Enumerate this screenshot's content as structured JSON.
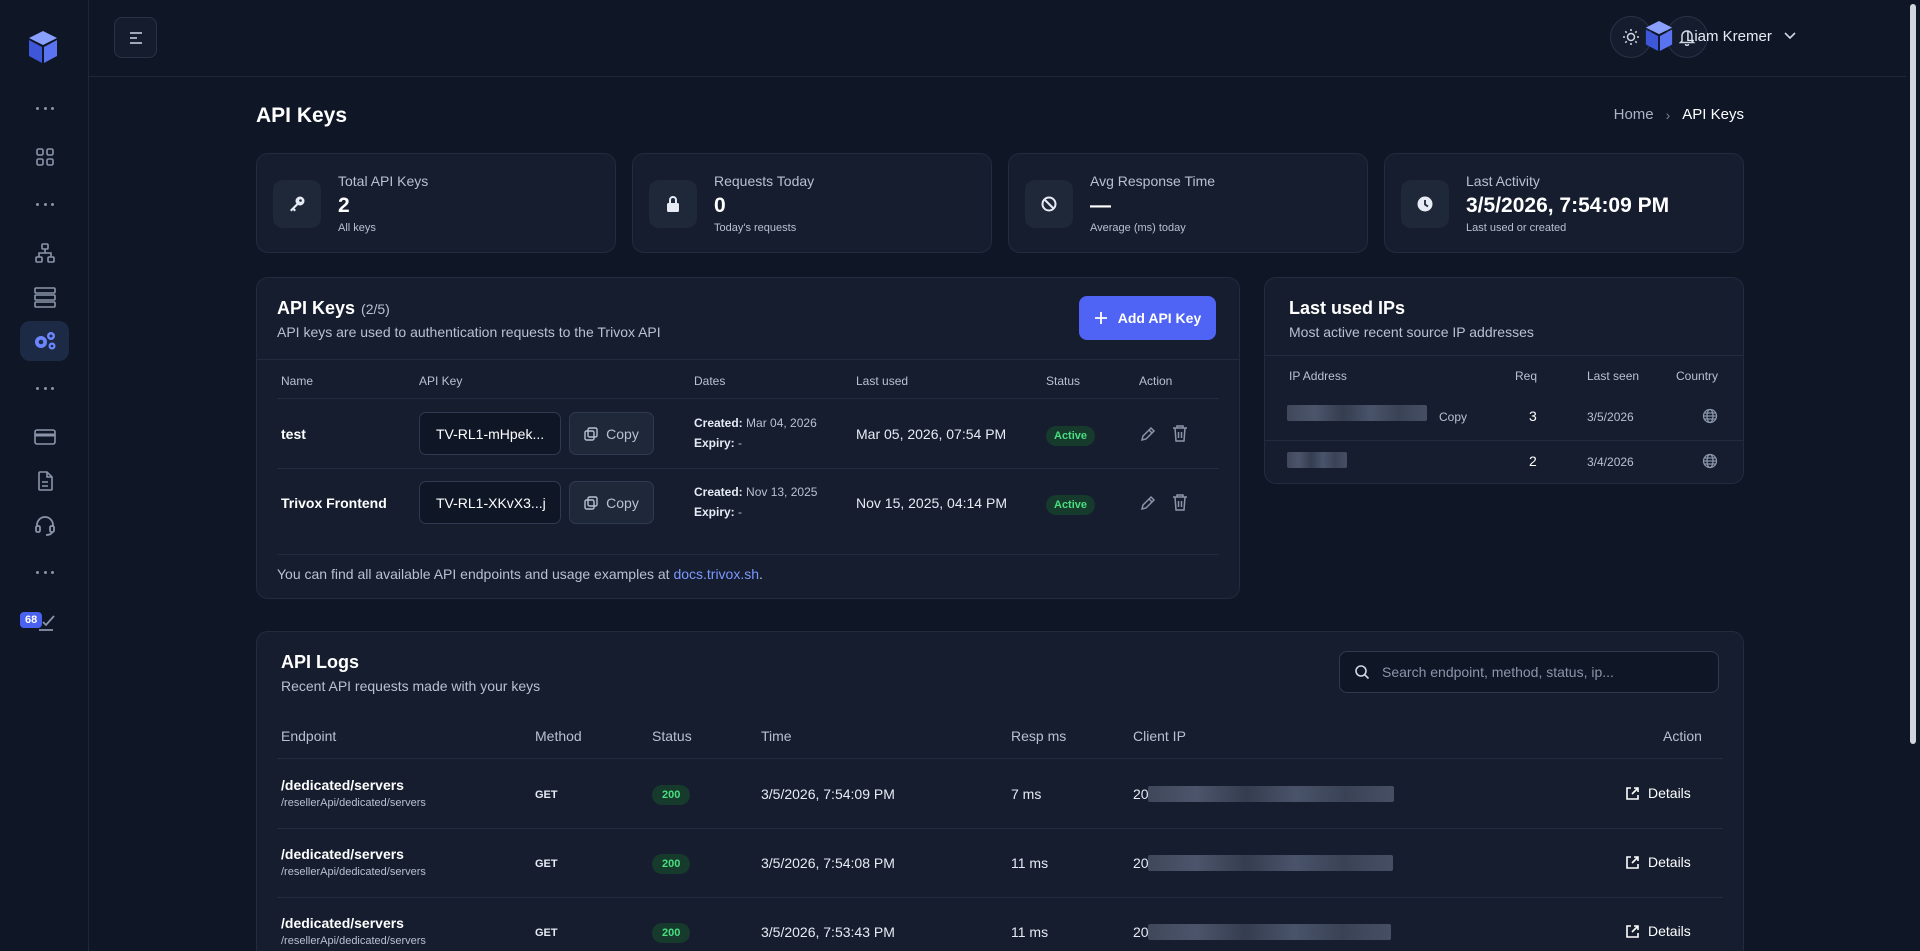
{
  "user": {
    "name": "Liam Kremer"
  },
  "sidebar": {
    "badge": "68"
  },
  "page": {
    "title": "API Keys"
  },
  "breadcrumb": {
    "home": "Home",
    "separator": "›",
    "current": "API Keys"
  },
  "stats": [
    {
      "label": "Total API Keys",
      "value": "2",
      "sub": "All keys",
      "icon": "key-icon"
    },
    {
      "label": "Requests Today",
      "value": "0",
      "sub": "Today's requests",
      "icon": "lock-icon"
    },
    {
      "label": "Avg Response Time",
      "value": "—",
      "sub": "Average (ms) today",
      "icon": "ban-icon"
    },
    {
      "label": "Last Activity",
      "value": "3/5/2026, 7:54:09 PM",
      "sub": "Last used or created",
      "icon": "clock-icon"
    }
  ],
  "keys": {
    "title": "API Keys",
    "count": "(2/5)",
    "subtitle": "API keys are used to authentication requests to the Trivox API",
    "add_label": "Add API Key",
    "columns": [
      "Name",
      "API Key",
      "Dates",
      "Last used",
      "Status",
      "Action"
    ],
    "copy_label": "Copy",
    "created_label": "Created:",
    "expiry_label": "Expiry:",
    "rows": [
      {
        "name": "test",
        "key": "TV-RL1-mHpek...",
        "created": "Mar 04, 2026",
        "expiry": "-",
        "last_used": "Mar 05, 2026, 07:54 PM",
        "status": "Active"
      },
      {
        "name": "Trivox Frontend",
        "key": "TV-RL1-XKvX3...j",
        "created": "Nov 13, 2025",
        "expiry": "-",
        "last_used": "Nov 15, 2025, 04:14 PM",
        "status": "Active"
      }
    ],
    "footer_text": "You can find all available API endpoints and usage examples at",
    "footer_link": "docs.trivox.sh",
    "footer_end": "."
  },
  "ips": {
    "title": "Last used IPs",
    "subtitle": "Most active recent source IP addresses",
    "columns": [
      "IP Address",
      "Req",
      "Last seen",
      "Country"
    ],
    "copy_label": "Copy",
    "rows": [
      {
        "req": "3",
        "last_seen": "3/5/2026"
      },
      {
        "req": "2",
        "last_seen": "3/4/2026"
      }
    ]
  },
  "logs": {
    "title": "API Logs",
    "subtitle": "Recent API requests made with your keys",
    "search_placeholder": "Search endpoint, method, status, ip...",
    "columns": [
      "Endpoint",
      "Method",
      "Status",
      "Time",
      "Resp ms",
      "Client IP",
      "Action"
    ],
    "details_label": "Details",
    "rows": [
      {
        "endpoint": "/dedicated/servers",
        "path": "/resellerApi/dedicated/servers",
        "method": "GET",
        "status": "200",
        "time": "3/5/2026, 7:54:09 PM",
        "resp": "7 ms",
        "ip_prefix": "20"
      },
      {
        "endpoint": "/dedicated/servers",
        "path": "/resellerApi/dedicated/servers",
        "method": "GET",
        "status": "200",
        "time": "3/5/2026, 7:54:08 PM",
        "resp": "11 ms",
        "ip_prefix": "20"
      },
      {
        "endpoint": "/dedicated/servers",
        "path": "/resellerApi/dedicated/servers",
        "method": "GET",
        "status": "200",
        "time": "3/5/2026, 7:53:43 PM",
        "resp": "11 ms",
        "ip_prefix": "20"
      }
    ]
  },
  "colors": {
    "accent": "#4f63f5",
    "success": "#4ade80",
    "bg": "#0f1626",
    "card": "#151d2e"
  }
}
